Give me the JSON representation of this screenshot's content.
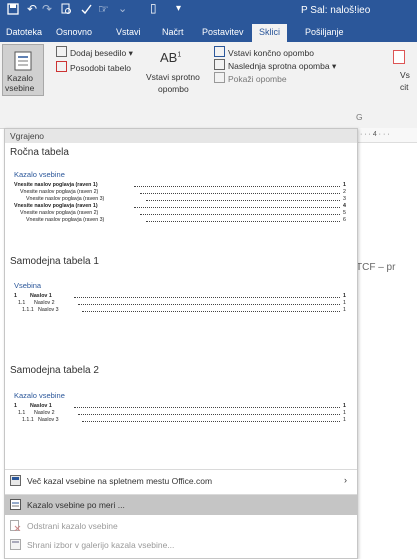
{
  "colors": {
    "title_bar": "#2b579a",
    "ribbon_bg": "#f2f2f2",
    "toc_heading": "#2b579a",
    "selected_item": "#c5c5c5"
  },
  "title_bar": {
    "icons": [
      "save-icon",
      "undo-icon",
      "redo-icon",
      "print-preview-icon",
      "spell-check-icon",
      "touch-mode-icon",
      "customize-toolbar-icon"
    ],
    "doc_title": "P Sal: naloš!ieo"
  },
  "tabs": [
    "Datoteka",
    "Osnovno",
    "Vstavi",
    "Načrt",
    "Postavitev",
    "Sklici",
    "Pošiljanje"
  ],
  "active_tab": "Sklici",
  "ribbon": {
    "toc_button_label_1": "Kazalo",
    "toc_button_label_2": "vsebine",
    "add_text": "Dodaj besedilo",
    "update_table": "Posodobi tabelo",
    "insert_footnote_1": "Vstavi sprotno",
    "insert_footnote_2": "opombo",
    "insert_endnote": "Vstavi končno opombo",
    "next_footnote": "Naslednja sprotna opomba",
    "show_notes": "Pokaži opombe",
    "cut_label_1": "Vs",
    "cut_label_2": "cit",
    "group_marker": "G"
  },
  "ruler_text": "· · · 4 · · ·",
  "dropdown": {
    "header": "Vgrajeno",
    "galleries": [
      {
        "title": "Ročna tabela",
        "toc_heading": "Kazalo vsebine",
        "lines": [
          {
            "text": "Vnesite naslov poglavja (raven 1)",
            "page": "1",
            "bold": true
          },
          {
            "text": "Vnesite naslov poglavja (raven 2)",
            "page": "2",
            "bold": false
          },
          {
            "text": "Vnesite naslov poglavja (raven 3)",
            "page": "3",
            "bold": false
          },
          {
            "text": "Vnesite naslov poglavja (raven 1)",
            "page": "4",
            "bold": true
          },
          {
            "text": "Vnesite naslov poglavja (raven 2)",
            "page": "5",
            "bold": false
          },
          {
            "text": "Vnesite naslov poglavja (raven 3)",
            "page": "6",
            "bold": false
          }
        ]
      },
      {
        "title": "Samodejna tabela 1",
        "toc_heading": "Vsebina",
        "lines": [
          {
            "num": "1",
            "text": "Naslov 1",
            "page": "1",
            "bold": true
          },
          {
            "num": "1.1",
            "text": "Naslov 2",
            "page": "1",
            "bold": false
          },
          {
            "num": "1.1.1",
            "text": "Naslov 3",
            "page": "1",
            "bold": false
          }
        ]
      },
      {
        "title": "Samodejna tabela 2",
        "toc_heading": "Kazalo vsebine",
        "lines": [
          {
            "num": "1",
            "text": "Naslov 1",
            "page": "1",
            "bold": true
          },
          {
            "num": "1.1",
            "text": "Naslov 2",
            "page": "1",
            "bold": false
          },
          {
            "num": "1.1.1",
            "text": "Naslov 3",
            "page": "1",
            "bold": false
          }
        ]
      }
    ],
    "menu_items": [
      {
        "label": "Več kazal vsebine na spletnem mestu Office.com",
        "icon": "office-icon",
        "arrow": "›",
        "selected": false,
        "disabled": false
      },
      {
        "label": "Kazalo vsebine po meri ...",
        "icon": "custom-toc-icon",
        "arrow": "",
        "selected": true,
        "disabled": false
      },
      {
        "label": "Odstrani kazalo vsebine",
        "icon": "remove-toc-icon",
        "arrow": "",
        "selected": false,
        "disabled": true
      },
      {
        "label": "Shrani izbor v galerijo kazala vsebine...",
        "icon": "save-selection-icon",
        "arrow": "",
        "selected": false,
        "disabled": true
      }
    ]
  },
  "document_text": "TCF – pr"
}
